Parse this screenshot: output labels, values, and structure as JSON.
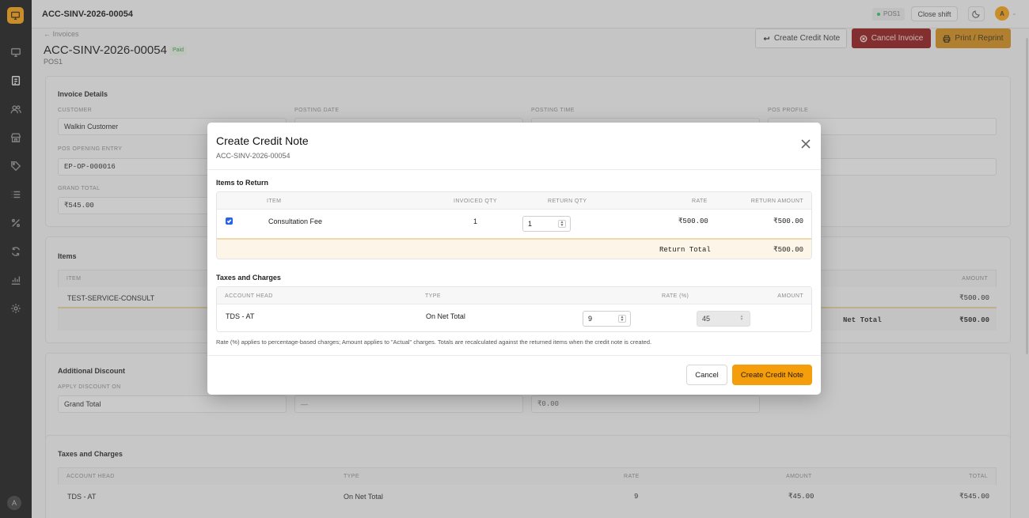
{
  "topbar": {
    "title": "ACC-SINV-2026-00054",
    "pos_badge": "POS1",
    "close_shift": "Close shift",
    "avatar": "A"
  },
  "sidebar": {
    "avatar": "A",
    "icons": [
      "monitor-icon",
      "invoice-icon",
      "users-icon",
      "store-icon",
      "tag-icon",
      "list-icon",
      "percent-icon",
      "sync-icon",
      "chart-icon",
      "settings-icon"
    ],
    "active": "invoice-icon"
  },
  "header": {
    "back": "← Invoices",
    "title": "ACC-SINV-2026-00054",
    "status": "Paid",
    "pos_profile": "POS1",
    "create_credit_note": "Create Credit Note",
    "cancel_invoice": "Cancel Invoice",
    "print": "Print / Reprint"
  },
  "details": {
    "title": "Invoice Details",
    "customer_label": "CUSTOMER",
    "customer": "Walkin Customer",
    "posting_date_label": "POSTING DATE",
    "posting_time_label": "POSTING TIME",
    "pos_profile_label": "POS PROFILE",
    "opening_entry_label": "POS OPENING ENTRY",
    "opening_entry": "EP-OP-000016",
    "grand_total_label": "GRAND TOTAL",
    "grand_total": "₹545.00"
  },
  "items": {
    "title": "Items",
    "col_item": "ITEM",
    "col_amount": "AMOUNT",
    "row_item": "TEST-SERVICE-CONSULT",
    "row_amount": "₹500.00",
    "net_label": "Net Total",
    "net_value": "₹500.00"
  },
  "discount": {
    "title": "Additional Discount",
    "apply_label": "APPLY DISCOUNT ON",
    "apply_value": "Grand Total",
    "pct_value": "—",
    "amount_value": "₹0.00"
  },
  "taxes": {
    "title": "Taxes and Charges",
    "cols": [
      "ACCOUNT HEAD",
      "TYPE",
      "RATE",
      "AMOUNT",
      "TOTAL"
    ],
    "row": [
      "TDS - AT",
      "On Net Total",
      "9",
      "₹45.00",
      "₹545.00"
    ]
  },
  "modal": {
    "title": "Create Credit Note",
    "subtitle": "ACC-SINV-2026-00054",
    "items_section": "Items to Return",
    "item_cols": [
      "ITEM",
      "INVOICED QTY",
      "RETURN QTY",
      "RATE",
      "RETURN AMOUNT"
    ],
    "item_row": {
      "item": "Consultation Fee",
      "invoiced_qty": "1",
      "return_qty": "1",
      "rate": "₹500.00",
      "return_amount": "₹500.00"
    },
    "return_total_label": "Return Total",
    "return_total": "₹500.00",
    "tax_section": "Taxes and Charges",
    "tax_cols": [
      "ACCOUNT HEAD",
      "TYPE",
      "RATE (%)",
      "AMOUNT"
    ],
    "tax_row": {
      "account": "TDS - AT",
      "type": "On Net Total",
      "rate": "9",
      "amount": "45"
    },
    "note": "Rate (%) applies to percentage-based charges; Amount applies to \"Actual\" charges. Totals are recalculated against the returned items when the credit note is created.",
    "cancel": "Cancel",
    "create": "Create Credit Note"
  }
}
